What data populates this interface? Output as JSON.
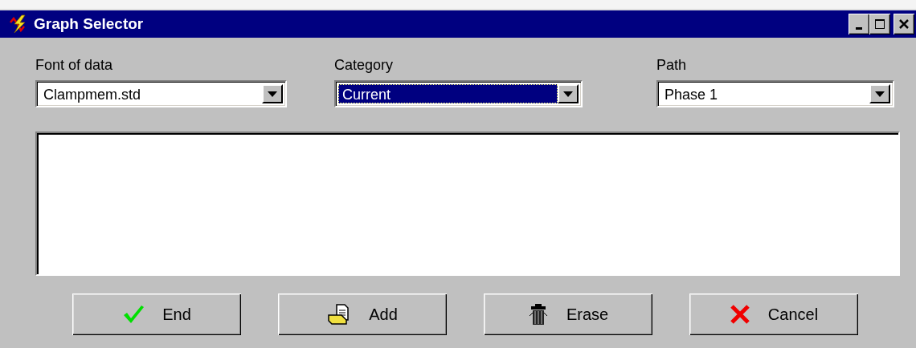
{
  "window": {
    "title": "Graph Selector"
  },
  "fields": [
    {
      "label": "Font of data",
      "value": "Clampmem.std",
      "focused": false
    },
    {
      "label": "Category",
      "value": "Current",
      "focused": true
    },
    {
      "label": "Path",
      "value": "Phase 1",
      "focused": false
    }
  ],
  "buttons": [
    {
      "label": "End",
      "kind": "check"
    },
    {
      "label": "Add",
      "kind": "add"
    },
    {
      "label": "Erase",
      "kind": "trash"
    },
    {
      "label": "Cancel",
      "kind": "cross"
    }
  ]
}
